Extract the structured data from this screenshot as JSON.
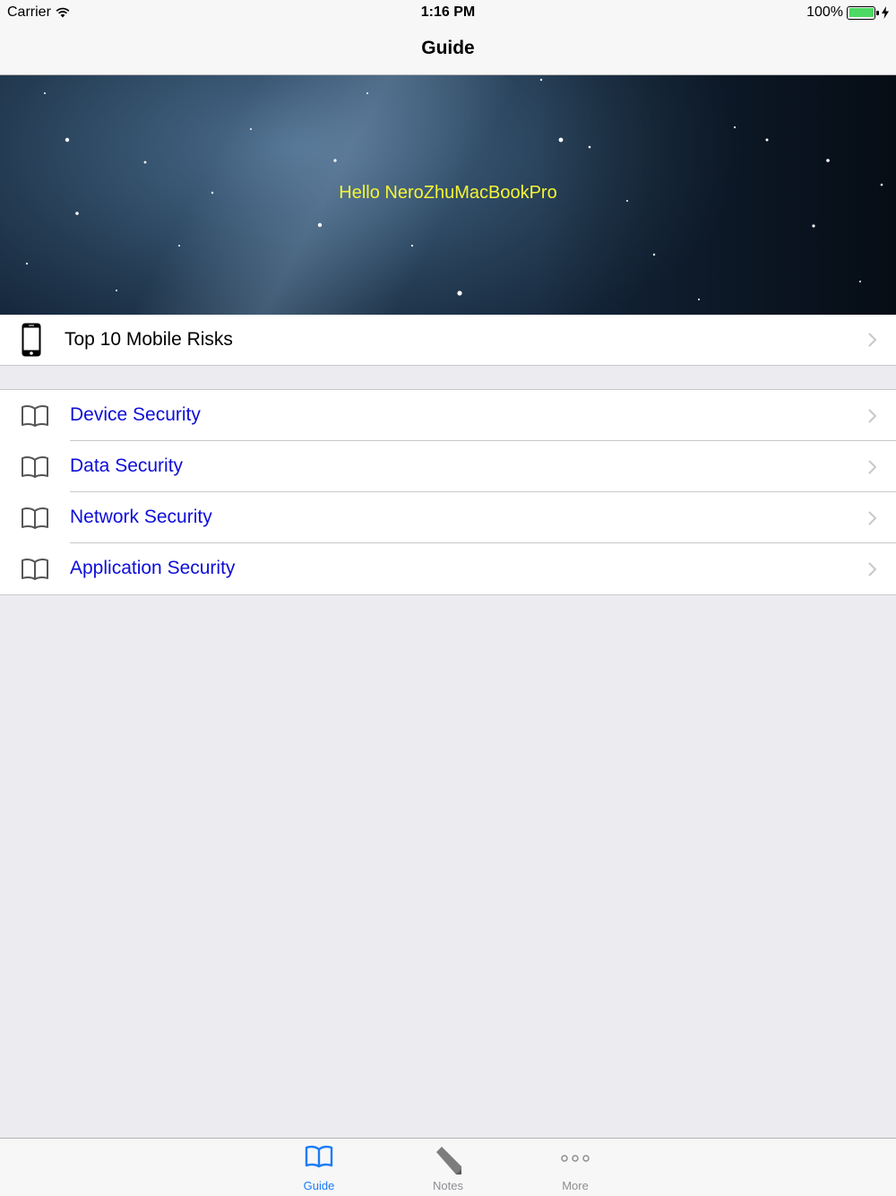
{
  "status_bar": {
    "carrier": "Carrier",
    "time": "1:16 PM",
    "battery": "100%",
    "battery_level": 1.0
  },
  "nav": {
    "title": "Guide"
  },
  "banner": {
    "greeting": "Hello NeroZhuMacBookPro"
  },
  "top_cell": {
    "label": "Top 10 Mobile Risks",
    "icon": "phone-icon"
  },
  "sections": [
    {
      "label": "Device Security",
      "icon": "book-icon"
    },
    {
      "label": "Data Security",
      "icon": "book-icon"
    },
    {
      "label": "Network Security",
      "icon": "book-icon"
    },
    {
      "label": "Application Security",
      "icon": "book-icon"
    }
  ],
  "tabs": [
    {
      "label": "Guide",
      "icon": "book-icon",
      "active": true
    },
    {
      "label": "Notes",
      "icon": "pencil-icon",
      "active": false
    },
    {
      "label": "More",
      "icon": "more-icon",
      "active": false
    }
  ],
  "colors": {
    "link_text": "#0e0ed8",
    "banner_text": "#f5f536",
    "tab_active": "#1b7cf5",
    "tab_inactive": "#8e8e93",
    "battery": "#4cd964"
  }
}
